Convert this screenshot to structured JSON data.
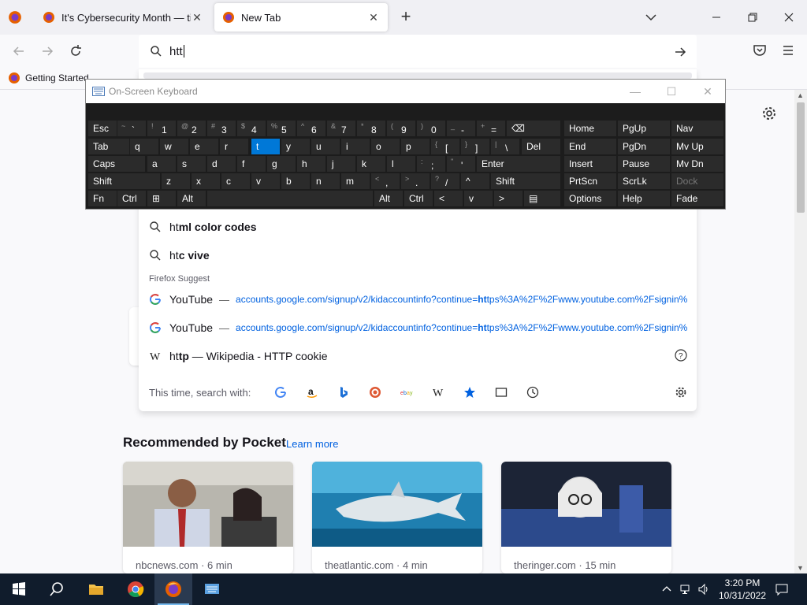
{
  "browser": {
    "tabs": [
      {
        "title": "It's Cybersecurity Month — tim",
        "active": false
      },
      {
        "title": "New Tab",
        "active": true
      }
    ],
    "url_text": "htt",
    "bookmarks": [
      {
        "label": "Getting Started"
      }
    ]
  },
  "dropdown": {
    "suggestions": [
      {
        "prefix": "ht",
        "rest": "ml color codes"
      },
      {
        "prefix": "ht",
        "rest": "c vive"
      }
    ],
    "group_label": "Firefox Suggest",
    "suggest_rows": [
      {
        "title": "YouTube",
        "dash": "—",
        "url_pre": "accounts.google.com/signup/v2/kidaccountinfo?continue=",
        "url_bold": "ht",
        "url_post": "tps%3A%2F%2Fwww.youtube.com%2Fsignin%"
      },
      {
        "title": "YouTube",
        "dash": "—",
        "url_pre": "accounts.google.com/signup/v2/kidaccountinfo?continue=",
        "url_bold": "ht",
        "url_post": "tps%3A%2F%2Fwww.youtube.com%2Fsignin%"
      }
    ],
    "wiki_row": {
      "prefix": "ht",
      "bold": "tp",
      "rest": " — Wikipedia - HTTP cookie"
    },
    "oneoff_label": "This time, search with:",
    "engines": [
      "google",
      "amazon",
      "bing",
      "duckduckgo",
      "ebay",
      "wikipedia",
      "bookmarks",
      "tabs",
      "history"
    ]
  },
  "osk": {
    "title": "On-Screen Keyboard",
    "rows": [
      [
        {
          "label": "Esc"
        },
        {
          "shift": "~",
          "label": "`"
        },
        {
          "shift": "!",
          "label": "1"
        },
        {
          "shift": "@",
          "label": "2"
        },
        {
          "shift": "#",
          "label": "3"
        },
        {
          "shift": "$",
          "label": "4"
        },
        {
          "shift": "%",
          "label": "5"
        },
        {
          "shift": "^",
          "label": "6"
        },
        {
          "shift": "&",
          "label": "7"
        },
        {
          "shift": "*",
          "label": "8"
        },
        {
          "shift": "(",
          "label": "9"
        },
        {
          "shift": ")",
          "label": "0"
        },
        {
          "shift": "_",
          "label": "-"
        },
        {
          "shift": "+",
          "label": "="
        },
        {
          "label": "⌫"
        }
      ],
      [
        {
          "label": "Tab"
        },
        {
          "label": "q"
        },
        {
          "label": "w"
        },
        {
          "label": "e"
        },
        {
          "label": "r"
        },
        {
          "label": "t",
          "highlight": true
        },
        {
          "label": "y"
        },
        {
          "label": "u"
        },
        {
          "label": "i"
        },
        {
          "label": "o"
        },
        {
          "label": "p"
        },
        {
          "shift": "{",
          "label": "["
        },
        {
          "shift": "}",
          "label": "]"
        },
        {
          "shift": "|",
          "label": "\\"
        },
        {
          "label": "Del"
        }
      ],
      [
        {
          "label": "Caps"
        },
        {
          "label": "a"
        },
        {
          "label": "s"
        },
        {
          "label": "d"
        },
        {
          "label": "f"
        },
        {
          "label": "g"
        },
        {
          "label": "h"
        },
        {
          "label": "j"
        },
        {
          "label": "k"
        },
        {
          "label": "l"
        },
        {
          "shift": ":",
          "label": ";"
        },
        {
          "shift": "\"",
          "label": "'"
        },
        {
          "label": "Enter"
        }
      ],
      [
        {
          "label": "Shift"
        },
        {
          "label": "z"
        },
        {
          "label": "x"
        },
        {
          "label": "c"
        },
        {
          "label": "v"
        },
        {
          "label": "b"
        },
        {
          "label": "n"
        },
        {
          "label": "m"
        },
        {
          "shift": "<",
          "label": ","
        },
        {
          "shift": ">",
          "label": "."
        },
        {
          "shift": "?",
          "label": "/"
        },
        {
          "label": "^"
        },
        {
          "label": "Shift"
        }
      ],
      [
        {
          "label": "Fn"
        },
        {
          "label": "Ctrl"
        },
        {
          "label": "⊞"
        },
        {
          "label": "Alt"
        },
        {
          "label": ""
        },
        {
          "label": "Alt"
        },
        {
          "label": "Ctrl"
        },
        {
          "label": "<"
        },
        {
          "label": "v"
        },
        {
          "label": ">"
        },
        {
          "label": "▤"
        }
      ]
    ],
    "side_keys": [
      [
        "Home",
        "PgUp",
        "Nav"
      ],
      [
        "End",
        "PgDn",
        "Mv Up"
      ],
      [
        "Insert",
        "Pause",
        "Mv Dn"
      ],
      [
        "PrtScn",
        "ScrLk",
        "Dock"
      ],
      [
        "Options",
        "Help",
        "Fade"
      ]
    ]
  },
  "pocket": {
    "title": "Recommended by Pocket",
    "learn_more": "Learn more",
    "cards": [
      {
        "source": "nbcnews.com · 6 min"
      },
      {
        "source": "theatlantic.com · 4 min"
      },
      {
        "source": "theringer.com · 15 min"
      }
    ]
  },
  "taskbar": {
    "time": "3:20 PM",
    "date": "10/31/2022"
  },
  "colors": {
    "accent": "#0061e0",
    "osk_highlight": "#0078d7",
    "osk_bg": "#1c1c1c",
    "taskbar": "#101c2c"
  }
}
